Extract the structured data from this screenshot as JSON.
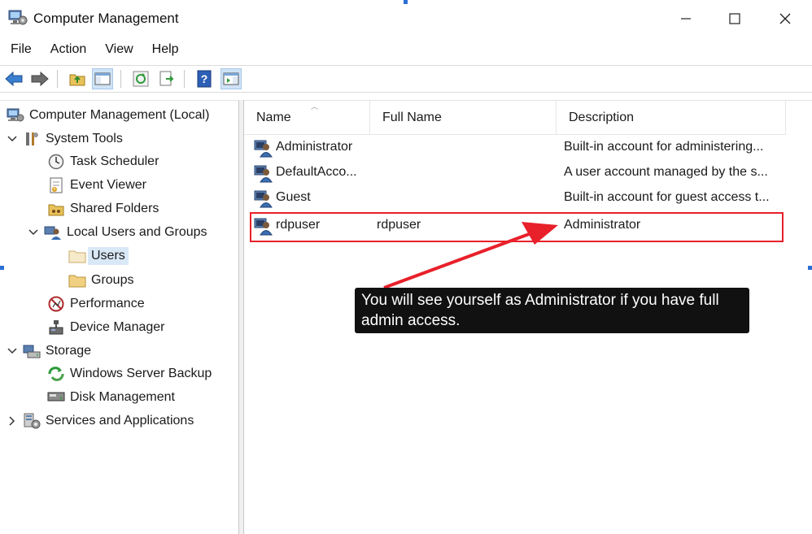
{
  "window": {
    "title": "Computer Management"
  },
  "menu": {
    "items": [
      "File",
      "Action",
      "View",
      "Help"
    ]
  },
  "tree": {
    "root": "Computer Management (Local)",
    "system_tools": "System Tools",
    "task_scheduler": "Task Scheduler",
    "event_viewer": "Event Viewer",
    "shared_folders": "Shared Folders",
    "local_users_groups": "Local Users and Groups",
    "users": "Users",
    "groups": "Groups",
    "performance": "Performance",
    "device_manager": "Device Manager",
    "storage": "Storage",
    "windows_server_backup": "Windows Server Backup",
    "disk_management": "Disk Management",
    "services_apps": "Services and Applications"
  },
  "list": {
    "columns": [
      "Name",
      "Full Name",
      "Description"
    ],
    "rows": [
      {
        "name": "Administrator",
        "full_name": "",
        "description": "Built-in account for administering..."
      },
      {
        "name": "DefaultAcco...",
        "full_name": "",
        "description": "A user account managed by the s..."
      },
      {
        "name": "Guest",
        "full_name": "",
        "description": "Built-in account for guest access t..."
      },
      {
        "name": "rdpuser",
        "full_name": "rdpuser",
        "description": "Administrator"
      }
    ]
  },
  "annotation": {
    "callout_text": "You will see yourself as Administrator if you have full admin access.",
    "color": "#e8202a"
  }
}
